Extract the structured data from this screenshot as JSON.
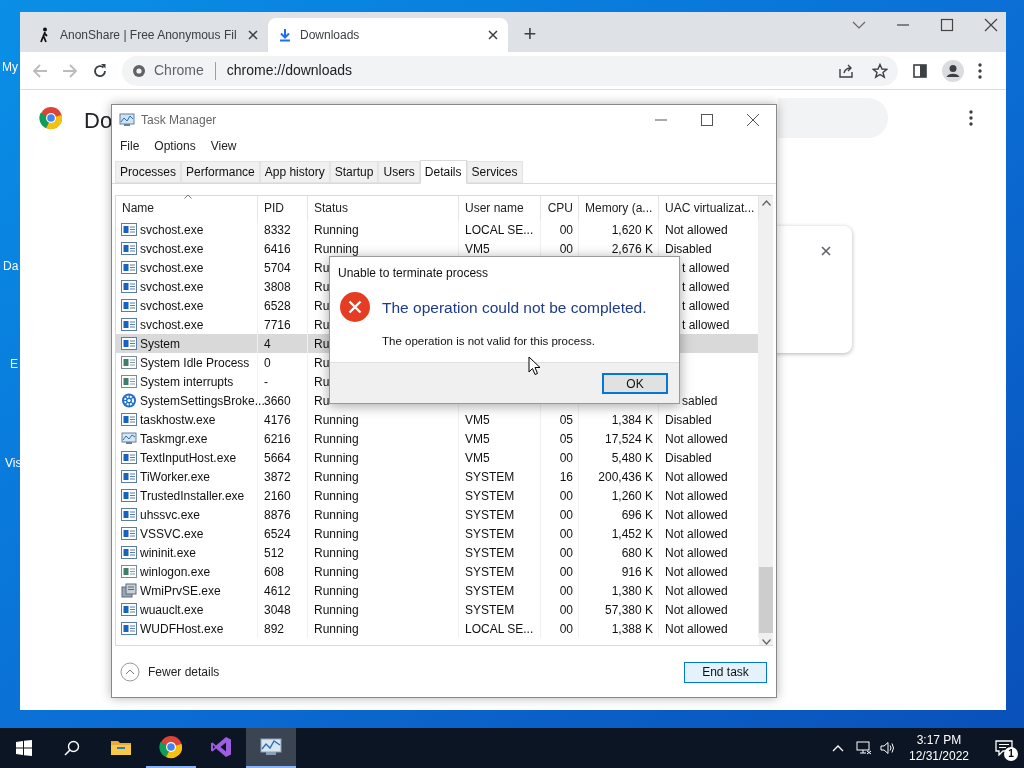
{
  "desktop": {
    "icon_labels": [
      "My",
      "Da",
      "E",
      "Vis"
    ]
  },
  "browser": {
    "tabs": [
      {
        "title": "AnonShare | Free Anonymous Fil",
        "selected": false
      },
      {
        "title": "Downloads",
        "selected": true
      }
    ],
    "new_tab": "+",
    "omnibox": {
      "chip": "Chrome",
      "url": "chrome://downloads"
    },
    "page": {
      "heading": "Do"
    }
  },
  "task_manager": {
    "title": "Task Manager",
    "menu": [
      "File",
      "Options",
      "View"
    ],
    "tabs": [
      {
        "label": "Processes",
        "selected": false
      },
      {
        "label": "Performance",
        "selected": false
      },
      {
        "label": "App history",
        "selected": false
      },
      {
        "label": "Startup",
        "selected": false
      },
      {
        "label": "Users",
        "selected": false
      },
      {
        "label": "Details",
        "selected": true
      },
      {
        "label": "Services",
        "selected": false
      }
    ],
    "columns": [
      "Name",
      "PID",
      "Status",
      "User name",
      "CPU",
      "Memory (a...",
      "UAC virtualizat..."
    ],
    "rows": [
      {
        "kind": "app",
        "name": "svchost.exe",
        "pid": "8332",
        "status": "Running",
        "user": "LOCAL SE...",
        "cpu": "00",
        "memory": "1,620 K",
        "uac": "Not allowed",
        "selected": false
      },
      {
        "kind": "app",
        "name": "svchost.exe",
        "pid": "6416",
        "status": "Running",
        "user": "VM5",
        "cpu": "00",
        "memory": "2,676 K",
        "uac": "Disabled",
        "selected": false
      },
      {
        "kind": "app",
        "name": "svchost.exe",
        "pid": "5704",
        "status": "Ru",
        "uac": "t allowed",
        "selected": false
      },
      {
        "kind": "app",
        "name": "svchost.exe",
        "pid": "3808",
        "status": "Ru",
        "uac": "t allowed",
        "selected": false
      },
      {
        "kind": "app",
        "name": "svchost.exe",
        "pid": "6528",
        "status": "Ru",
        "uac": "t allowed",
        "selected": false
      },
      {
        "kind": "app",
        "name": "svchost.exe",
        "pid": "7716",
        "status": "Ru",
        "uac": "t allowed",
        "selected": false
      },
      {
        "kind": "app",
        "name": "System",
        "pid": "4",
        "status": "Ru",
        "selected": true
      },
      {
        "kind": "plain",
        "name": "System Idle Process",
        "pid": "0",
        "status": "Ru",
        "selected": false
      },
      {
        "kind": "plain",
        "name": "System interrupts",
        "pid": "-",
        "status": "Ru",
        "selected": false
      },
      {
        "kind": "gear",
        "name": "SystemSettingsBroke...",
        "pid": "3660",
        "status": "Ru",
        "uac": "sabled",
        "selected": false
      },
      {
        "kind": "app",
        "name": "taskhostw.exe",
        "pid": "4176",
        "status": "Running",
        "user": "VM5",
        "cpu": "05",
        "memory": "1,384 K",
        "uac": "Disabled",
        "selected": false
      },
      {
        "kind": "monitor",
        "name": "Taskmgr.exe",
        "pid": "6216",
        "status": "Running",
        "user": "VM5",
        "cpu": "05",
        "memory": "17,524 K",
        "uac": "Not allowed",
        "selected": false
      },
      {
        "kind": "app",
        "name": "TextInputHost.exe",
        "pid": "5664",
        "status": "Running",
        "user": "VM5",
        "cpu": "00",
        "memory": "5,480 K",
        "uac": "Disabled",
        "selected": false
      },
      {
        "kind": "app",
        "name": "TiWorker.exe",
        "pid": "3872",
        "status": "Running",
        "user": "SYSTEM",
        "cpu": "16",
        "memory": "200,436 K",
        "uac": "Not allowed",
        "selected": false
      },
      {
        "kind": "app",
        "name": "TrustedInstaller.exe",
        "pid": "2160",
        "status": "Running",
        "user": "SYSTEM",
        "cpu": "00",
        "memory": "1,260 K",
        "uac": "Not allowed",
        "selected": false
      },
      {
        "kind": "app",
        "name": "uhssvc.exe",
        "pid": "8876",
        "status": "Running",
        "user": "SYSTEM",
        "cpu": "00",
        "memory": "696 K",
        "uac": "Not allowed",
        "selected": false
      },
      {
        "kind": "app",
        "name": "VSSVC.exe",
        "pid": "6524",
        "status": "Running",
        "user": "SYSTEM",
        "cpu": "00",
        "memory": "1,452 K",
        "uac": "Not allowed",
        "selected": false
      },
      {
        "kind": "app",
        "name": "wininit.exe",
        "pid": "512",
        "status": "Running",
        "user": "SYSTEM",
        "cpu": "00",
        "memory": "680 K",
        "uac": "Not allowed",
        "selected": false
      },
      {
        "kind": "plain",
        "name": "winlogon.exe",
        "pid": "608",
        "status": "Running",
        "user": "SYSTEM",
        "cpu": "00",
        "memory": "916 K",
        "uac": "Not allowed",
        "selected": false
      },
      {
        "kind": "wmi",
        "name": "WmiPrvSE.exe",
        "pid": "4612",
        "status": "Running",
        "user": "SYSTEM",
        "cpu": "00",
        "memory": "1,380 K",
        "uac": "Not allowed",
        "selected": false
      },
      {
        "kind": "app",
        "name": "wuauclt.exe",
        "pid": "3048",
        "status": "Running",
        "user": "SYSTEM",
        "cpu": "00",
        "memory": "57,380 K",
        "uac": "Not allowed",
        "selected": false
      },
      {
        "kind": "app",
        "name": "WUDFHost.exe",
        "pid": "892",
        "status": "Running",
        "user": "LOCAL SE...",
        "cpu": "00",
        "memory": "1,388 K",
        "uac": "Not allowed",
        "selected": false
      }
    ],
    "fewer_details": "Fewer details",
    "end_task": "End task"
  },
  "dialog": {
    "title": "Unable to terminate process",
    "heading": "The operation could not be completed.",
    "message": "The operation is not valid for this process.",
    "ok": "OK"
  },
  "taskbar": {
    "apps": [
      {
        "kind": "explorer",
        "selected": false
      },
      {
        "kind": "chrome",
        "selected": false
      },
      {
        "kind": "studio",
        "selected": false
      },
      {
        "kind": "taskmgr",
        "selected": true
      }
    ],
    "time": "3:17 PM",
    "date": "12/31/2022",
    "notifications": "1"
  }
}
